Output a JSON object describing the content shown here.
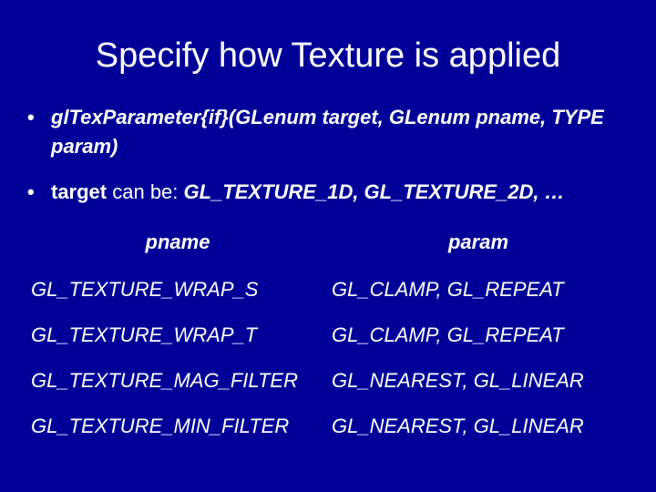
{
  "title": "Specify how Texture is applied",
  "bullet1": {
    "fn_prefix": "glTexParameter{",
    "fn_types": "if",
    "fn_suffix": "}(GLenum target, GLenum pname, TYPE",
    "line2": "param)"
  },
  "bullet2": {
    "label": "target",
    "mid": " can be: ",
    "vals": "GL_TEXTURE_1D, GL_TEXTURE_2D, …"
  },
  "table": {
    "headers": {
      "pname": "pname",
      "param": "param"
    },
    "rows": [
      {
        "pname": "GL_TEXTURE_WRAP_S",
        "param": "GL_CLAMP, GL_REPEAT"
      },
      {
        "pname": "GL_TEXTURE_WRAP_T",
        "param": "GL_CLAMP, GL_REPEAT"
      },
      {
        "pname": "GL_TEXTURE_MAG_FILTER",
        "param": "GL_NEAREST, GL_LINEAR"
      },
      {
        "pname": "GL_TEXTURE_MIN_FILTER",
        "param": "GL_NEAREST, GL_LINEAR"
      }
    ]
  }
}
